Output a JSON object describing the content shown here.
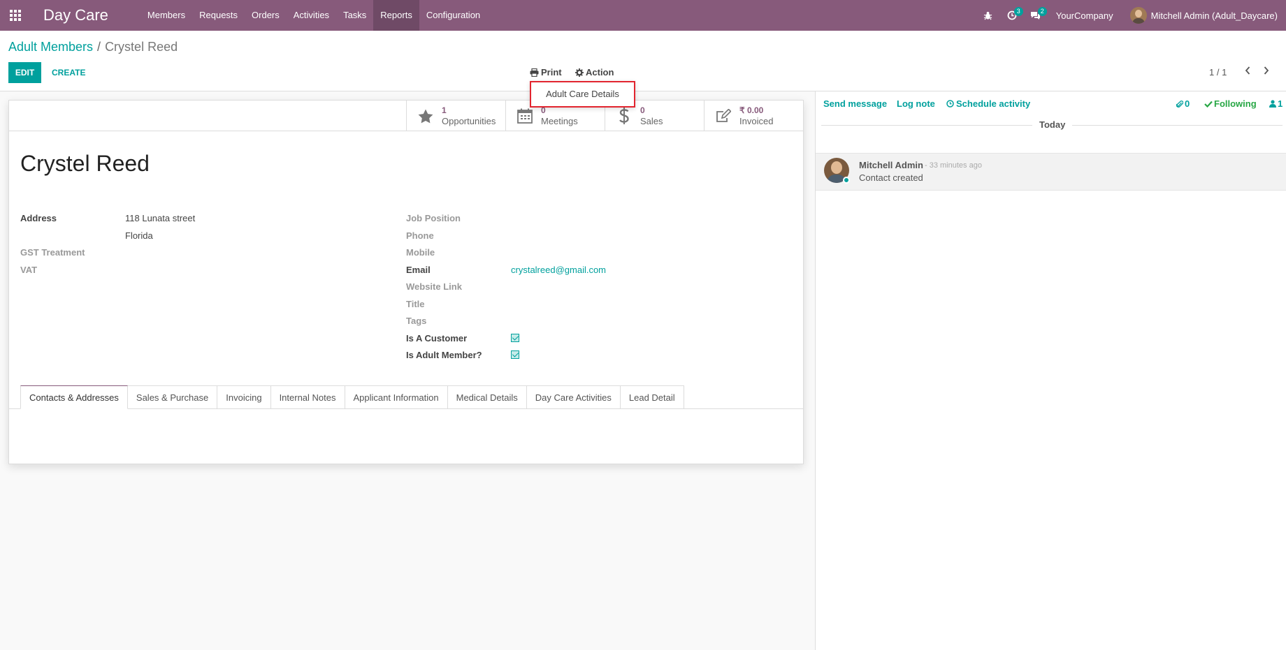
{
  "navbar": {
    "brand": "Day Care",
    "menu": [
      "Members",
      "Requests",
      "Orders",
      "Activities",
      "Tasks",
      "Reports",
      "Configuration"
    ],
    "active_menu": "Reports",
    "activity_badge": "3",
    "messages_badge": "2",
    "company": "YourCompany",
    "user": "Mitchell Admin (Adult_Daycare)"
  },
  "breadcrumb": {
    "parent": "Adult Members",
    "separator": "/",
    "current": "Crystel Reed"
  },
  "control_panel": {
    "edit_label": "EDIT",
    "create_label": "CREATE",
    "print_label": "Print",
    "action_label": "Action",
    "pager": "1 / 1"
  },
  "print_dropdown": {
    "items": [
      "Adult Care Details"
    ]
  },
  "stat_buttons": [
    {
      "value": "1",
      "label": "Opportunities",
      "icon": "star-icon"
    },
    {
      "value": "0",
      "label": "Meetings",
      "icon": "calendar-icon"
    },
    {
      "value": "0",
      "label": "Sales",
      "icon": "dollar-icon"
    },
    {
      "value": "₹ 0.00",
      "label": "Invoiced",
      "icon": "edit-icon"
    }
  ],
  "record": {
    "name": "Crystel Reed",
    "left_fields": {
      "address_label": "Address",
      "street": "118 Lunata street",
      "state": "Florida",
      "gst_label": "GST Treatment",
      "vat_label": "VAT"
    },
    "right_fields": {
      "job_position_label": "Job Position",
      "phone_label": "Phone",
      "mobile_label": "Mobile",
      "email_label": "Email",
      "email": "crystalreed@gmail.com",
      "website_label": "Website Link",
      "title_label": "Title",
      "tags_label": "Tags",
      "is_customer_label": "Is A Customer",
      "is_adult_member_label": "Is Adult Member?"
    }
  },
  "tabs": [
    "Contacts & Addresses",
    "Sales & Purchase",
    "Invoicing",
    "Internal Notes",
    "Applicant Information",
    "Medical Details",
    "Day Care Activities",
    "Lead Detail"
  ],
  "chatter": {
    "send_message": "Send message",
    "log_note": "Log note",
    "schedule_activity": "Schedule activity",
    "attachments": "0",
    "following": "Following",
    "followers": "1",
    "date_separator": "Today",
    "message": {
      "author": "Mitchell Admin",
      "time": "- 33 minutes ago",
      "body": "Contact created"
    }
  },
  "colors": {
    "brand": "#875a7b",
    "accent": "#00a09d",
    "highlight": "#e2252f",
    "following": "#28a745"
  }
}
